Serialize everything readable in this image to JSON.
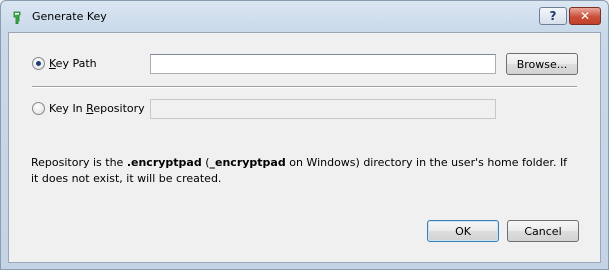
{
  "window": {
    "title": "Generate Key",
    "help_label": "?",
    "close_label": "✕"
  },
  "options": {
    "key_path": {
      "label_pre": "",
      "label_mnemonic": "K",
      "label_post": "ey Path",
      "selected": true,
      "value": "",
      "browse_label": "Browse..."
    },
    "key_in_repository": {
      "label_pre": "Key In ",
      "label_mnemonic": "R",
      "label_post": "epository",
      "selected": false,
      "value": ""
    }
  },
  "info": {
    "part1": "Repository is the ",
    "bold1": ".encryptpad",
    "part2": " (",
    "bold2": "_encryptpad",
    "part3": " on Windows) directory in the user's home folder. If it does not exist, it will be created."
  },
  "buttons": {
    "ok_label": "OK",
    "cancel_label": "Cancel"
  },
  "colors": {
    "accent": "#3c7fb1",
    "close": "#c9503a",
    "icon_green": "#3bb54a"
  }
}
